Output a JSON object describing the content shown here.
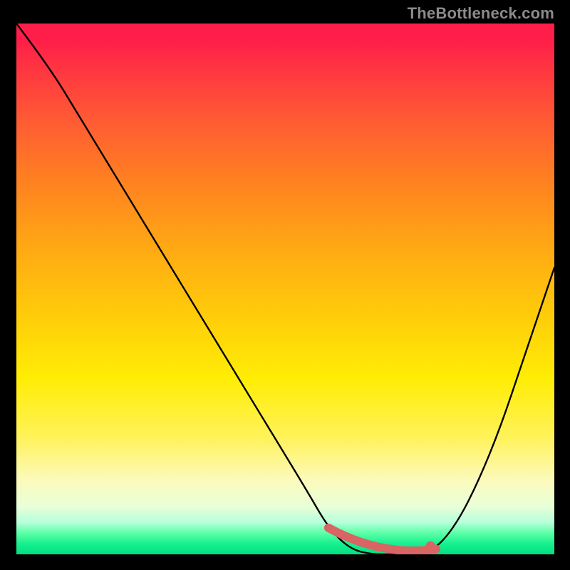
{
  "watermark": "TheBottleneck.com",
  "chart_data": {
    "type": "line",
    "title": "",
    "xlabel": "",
    "ylabel": "",
    "xlim": [
      0,
      100
    ],
    "ylim": [
      0,
      100
    ],
    "background_gradient": {
      "top": "#ff1d49",
      "middle": "#ffed05",
      "bottom": "#00e182"
    },
    "series": [
      {
        "name": "bottleneck-curve",
        "color": "#000000",
        "x": [
          0,
          6,
          12,
          18,
          24,
          30,
          36,
          42,
          48,
          54,
          58,
          62,
          66,
          70,
          74,
          78,
          82,
          86,
          90,
          94,
          100
        ],
        "y": [
          100,
          92,
          82,
          72,
          62,
          52,
          42,
          32,
          22,
          12,
          5,
          1,
          0,
          0,
          0,
          1,
          6,
          14,
          24,
          36,
          54
        ]
      }
    ],
    "highlight_band": {
      "x_start": 58,
      "x_end": 78,
      "color": "#d86464"
    },
    "highlight_dot": {
      "x": 77,
      "y": 1.6,
      "color": "#d86464"
    }
  }
}
